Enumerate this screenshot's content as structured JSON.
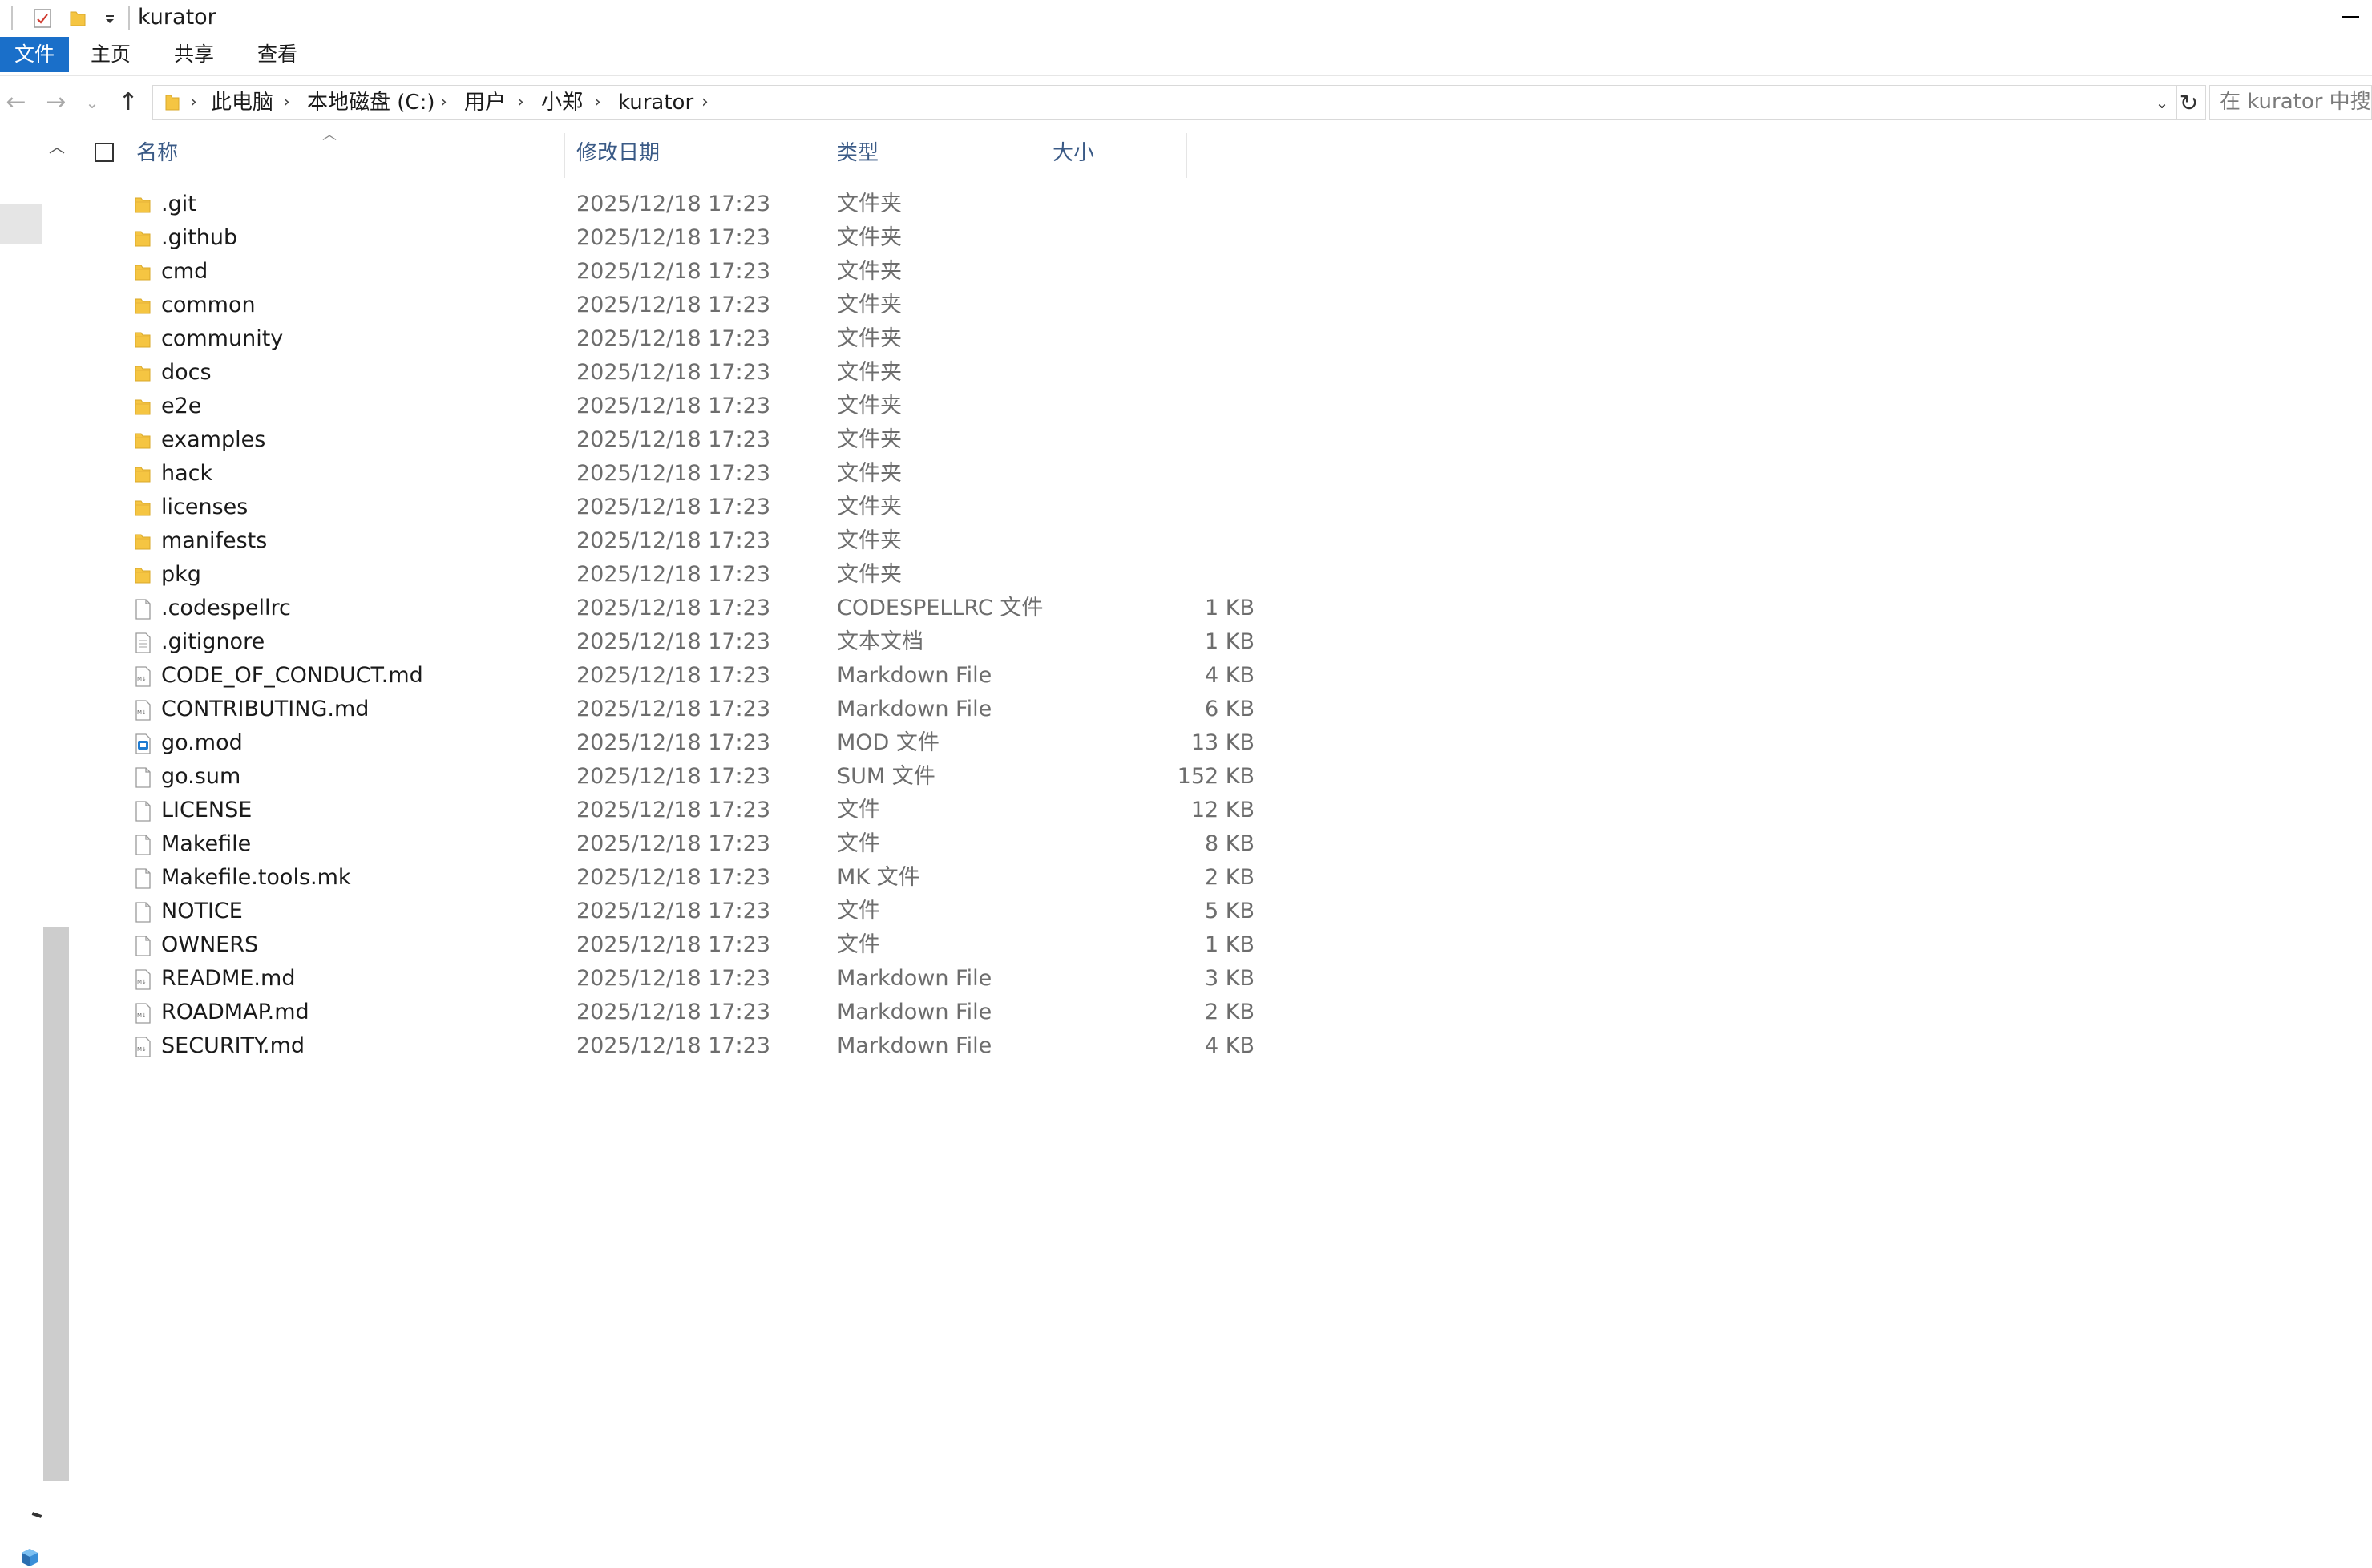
{
  "window": {
    "title": "kurator"
  },
  "ribbon": {
    "tabs": [
      "文件",
      "主页",
      "共享",
      "查看"
    ]
  },
  "address": {
    "crumbs": [
      "此电脑",
      "本地磁盘 (C:)",
      "用户",
      "小郑",
      "kurator"
    ],
    "search_placeholder": "在 kurator 中搜索"
  },
  "columns": {
    "name": "名称",
    "date": "修改日期",
    "type": "类型",
    "size": "大小"
  },
  "files": [
    {
      "name": ".git",
      "date": "2025/12/18 17:23",
      "type": "文件夹",
      "size": "",
      "icon": "folder-icon"
    },
    {
      "name": ".github",
      "date": "2025/12/18 17:23",
      "type": "文件夹",
      "size": "",
      "icon": "folder-icon"
    },
    {
      "name": "cmd",
      "date": "2025/12/18 17:23",
      "type": "文件夹",
      "size": "",
      "icon": "folder-icon"
    },
    {
      "name": "common",
      "date": "2025/12/18 17:23",
      "type": "文件夹",
      "size": "",
      "icon": "folder-icon"
    },
    {
      "name": "community",
      "date": "2025/12/18 17:23",
      "type": "文件夹",
      "size": "",
      "icon": "folder-icon"
    },
    {
      "name": "docs",
      "date": "2025/12/18 17:23",
      "type": "文件夹",
      "size": "",
      "icon": "folder-icon"
    },
    {
      "name": "e2e",
      "date": "2025/12/18 17:23",
      "type": "文件夹",
      "size": "",
      "icon": "folder-icon"
    },
    {
      "name": "examples",
      "date": "2025/12/18 17:23",
      "type": "文件夹",
      "size": "",
      "icon": "folder-icon"
    },
    {
      "name": "hack",
      "date": "2025/12/18 17:23",
      "type": "文件夹",
      "size": "",
      "icon": "folder-icon"
    },
    {
      "name": "licenses",
      "date": "2025/12/18 17:23",
      "type": "文件夹",
      "size": "",
      "icon": "folder-icon"
    },
    {
      "name": "manifests",
      "date": "2025/12/18 17:23",
      "type": "文件夹",
      "size": "",
      "icon": "folder-icon"
    },
    {
      "name": "pkg",
      "date": "2025/12/18 17:23",
      "type": "文件夹",
      "size": "",
      "icon": "folder-icon"
    },
    {
      "name": ".codespellrc",
      "date": "2025/12/18 17:23",
      "type": "CODESPELLRC 文件",
      "size": "1 KB",
      "icon": "file-icon"
    },
    {
      "name": ".gitignore",
      "date": "2025/12/18 17:23",
      "type": "文本文档",
      "size": "1 KB",
      "icon": "text-file-icon"
    },
    {
      "name": "CODE_OF_CONDUCT.md",
      "date": "2025/12/18 17:23",
      "type": "Markdown File",
      "size": "4 KB",
      "icon": "markdown-file-icon"
    },
    {
      "name": "CONTRIBUTING.md",
      "date": "2025/12/18 17:23",
      "type": "Markdown File",
      "size": "6 KB",
      "icon": "markdown-file-icon"
    },
    {
      "name": "go.mod",
      "date": "2025/12/18 17:23",
      "type": "MOD 文件",
      "size": "13 KB",
      "icon": "mod-file-icon"
    },
    {
      "name": "go.sum",
      "date": "2025/12/18 17:23",
      "type": "SUM 文件",
      "size": "152 KB",
      "icon": "file-icon"
    },
    {
      "name": "LICENSE",
      "date": "2025/12/18 17:23",
      "type": "文件",
      "size": "12 KB",
      "icon": "file-icon"
    },
    {
      "name": "Makefile",
      "date": "2025/12/18 17:23",
      "type": "文件",
      "size": "8 KB",
      "icon": "file-icon"
    },
    {
      "name": "Makefile.tools.mk",
      "date": "2025/12/18 17:23",
      "type": "MK 文件",
      "size": "2 KB",
      "icon": "file-icon"
    },
    {
      "name": "NOTICE",
      "date": "2025/12/18 17:23",
      "type": "文件",
      "size": "5 KB",
      "icon": "file-icon"
    },
    {
      "name": "OWNERS",
      "date": "2025/12/18 17:23",
      "type": "文件",
      "size": "1 KB",
      "icon": "file-icon"
    },
    {
      "name": "README.md",
      "date": "2025/12/18 17:23",
      "type": "Markdown File",
      "size": "3 KB",
      "icon": "markdown-file-icon"
    },
    {
      "name": "ROADMAP.md",
      "date": "2025/12/18 17:23",
      "type": "Markdown File",
      "size": "2 KB",
      "icon": "markdown-file-icon"
    },
    {
      "name": "SECURITY.md",
      "date": "2025/12/18 17:23",
      "type": "Markdown File",
      "size": "4 KB",
      "icon": "markdown-file-icon"
    }
  ],
  "colors": {
    "accent": "#1a6fc9",
    "folder": "#f5c542",
    "header_text": "#3a5a86",
    "secondary_text": "#6d6d6d"
  }
}
